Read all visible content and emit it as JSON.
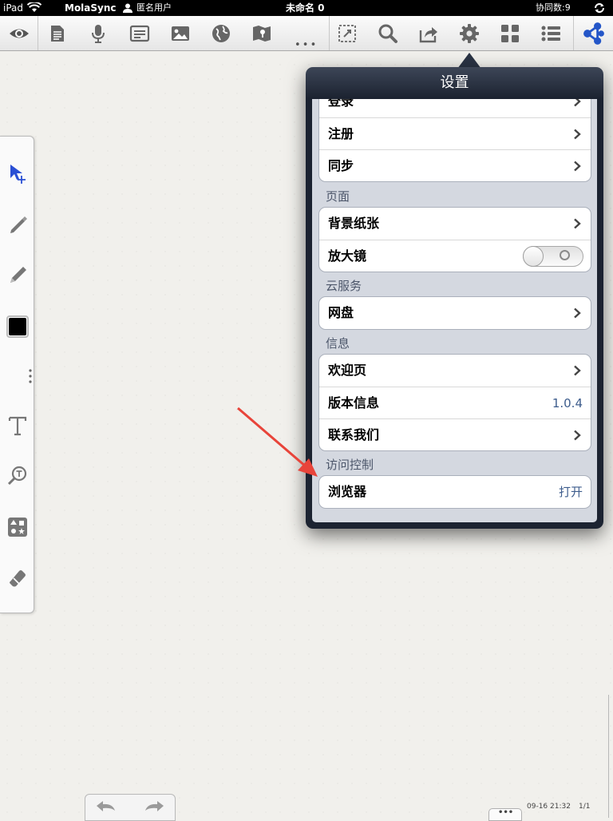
{
  "status_bar": {
    "device": "iPad",
    "app_name": "MolaSync",
    "user": "匿名用户",
    "document_title": "未命名 0",
    "collab_count": "协同数:9"
  },
  "toolbar": {
    "icons": [
      "eye-icon",
      "document-icon",
      "microphone-icon",
      "note-icon",
      "image-icon",
      "globe-icon",
      "map-icon",
      "more-dots-icon",
      "lasso-select-icon",
      "search-icon",
      "share-icon",
      "gear-icon",
      "grid-icon",
      "list-icon",
      "sync-share-icon"
    ],
    "more_label": "• • •"
  },
  "palette": {
    "icons": [
      "select-move-icon",
      "pen-icon",
      "pencil-icon",
      "color-swatch-icon",
      "palette-more-icon",
      "text-tool-icon",
      "text-search-icon",
      "shapes-icon",
      "eraser-icon"
    ],
    "selected_color": "#000000",
    "accent_color": "#2a4fd4"
  },
  "settings": {
    "title": "设置",
    "account_rows": [
      {
        "label": "登录"
      },
      {
        "label": "注册"
      },
      {
        "label": "同步"
      }
    ],
    "page_section": "页面",
    "page_rows": [
      {
        "label": "背景纸张"
      },
      {
        "label": "放大镜",
        "toggle": "off"
      }
    ],
    "cloud_section": "云服务",
    "cloud_rows": [
      {
        "label": "网盘"
      }
    ],
    "info_section": "信息",
    "info_rows": [
      {
        "label": "欢迎页"
      },
      {
        "label": "版本信息",
        "value": "1.0.4"
      },
      {
        "label": "联系我们"
      }
    ],
    "access_section": "访问控制",
    "access_rows": [
      {
        "label": "浏览器",
        "value": "打开"
      }
    ]
  },
  "annotation": {
    "arrow_color": "#e8443a"
  },
  "footer": {
    "timestamp": "09-16 21:32",
    "page": "1/1",
    "more_label": "•••"
  }
}
